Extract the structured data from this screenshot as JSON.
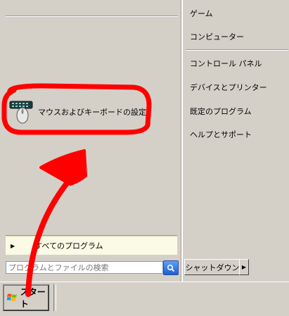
{
  "start_menu": {
    "pinned_items": [
      {
        "label": "マウスおよびキーボードの設定",
        "icon": "mouse-keyboard-icon"
      }
    ],
    "all_programs_label": "すべてのプログラム",
    "search": {
      "value": "",
      "placeholder": "プログラムとファイルの検索",
      "icon": "search-icon"
    },
    "right_items": {
      "games": "ゲーム",
      "computer": "コンピューター",
      "control_panel": "コントロール パネル",
      "devices_printers": "デバイスとプリンター",
      "default_programs": "既定のプログラム",
      "help_support": "ヘルプとサポート"
    },
    "shutdown_label": "シャットダウン"
  },
  "taskbar": {
    "start_label": "スタート",
    "start_icon": "windows-logo-icon"
  },
  "annotation_color": "#ff0000"
}
